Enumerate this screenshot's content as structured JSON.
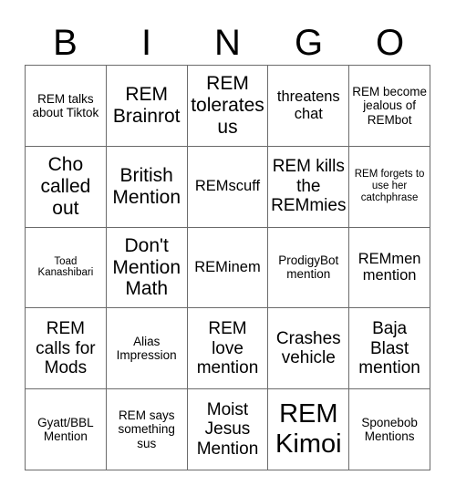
{
  "card": {
    "header_letters": [
      "B",
      "I",
      "N",
      "G",
      "O"
    ],
    "columns": [
      {
        "letter": "B",
        "cells": [
          "REM talks about Tiktok",
          "Cho called out",
          "Toad Kanashibari",
          "REM calls for Mods",
          "Gyatt/BBL Mention"
        ]
      },
      {
        "letter": "I",
        "cells": [
          "REM Brainrot",
          "British Mention",
          "Don't Mention Math",
          "Alias Impression",
          "REM says something sus"
        ]
      },
      {
        "letter": "N",
        "cells": [
          "REM tolerates us",
          "REMscuff",
          "REMinem",
          "REM love mention",
          "Moist Jesus Mention"
        ]
      },
      {
        "letter": "G",
        "cells": [
          "threatens chat",
          "REM kills the REMmies",
          "ProdigyBot mention",
          "Crashes vehicle",
          "REM Kimoi"
        ]
      },
      {
        "letter": "O",
        "cells": [
          "REM become jealous of REMbot",
          "REM forgets to use her catchphrase",
          "REMmen mention",
          "Baja Blast mention",
          "Sponebob Mentions"
        ]
      }
    ],
    "rows": [
      [
        "REM talks about Tiktok",
        "REM Brainrot",
        "REM tolerates us",
        "threatens chat",
        "REM become jealous of REMbot"
      ],
      [
        "Cho called out",
        "British Mention",
        "REMscuff",
        "REM kills the REMmies",
        "REM forgets to use her catchphrase"
      ],
      [
        "Toad Kanashibari",
        "Don't Mention Math",
        "REMinem",
        "ProdigyBot mention",
        "REMmen mention"
      ],
      [
        "REM calls for Mods",
        "Alias Impression",
        "REM love mention",
        "Crashes vehicle",
        "Baja Blast mention"
      ],
      [
        "Gyatt/BBL Mention",
        "REM says something sus",
        "Moist Jesus Mention",
        "REM Kimoi",
        "Sponebob Mentions"
      ]
    ]
  },
  "colors": {
    "background": "#ffffff",
    "text": "#000000",
    "grid_line": "#6b6b6b"
  }
}
